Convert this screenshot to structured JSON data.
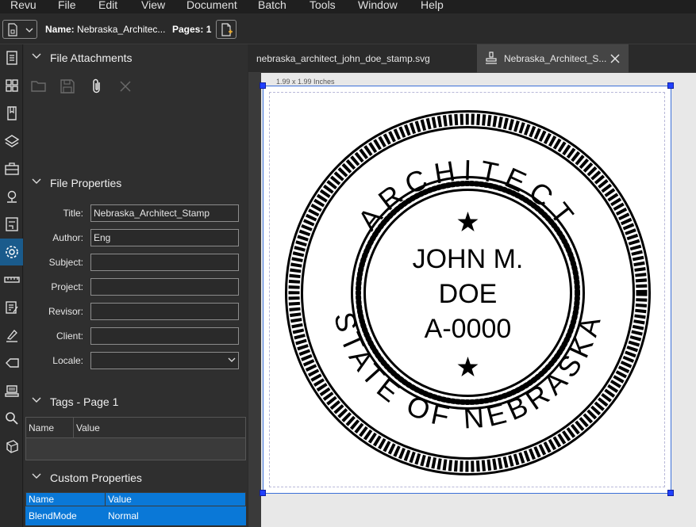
{
  "menu": [
    "Revu",
    "File",
    "Edit",
    "View",
    "Document",
    "Batch",
    "Tools",
    "Window",
    "Help"
  ],
  "toolbar": {
    "name_label": "Name:",
    "name_value": "Nebraska_Architec...",
    "pages_label": "Pages:",
    "pages_value": "1"
  },
  "sidebar_icons": [
    "document-icon",
    "thumbnails-icon",
    "bookmarks-icon",
    "layers-icon",
    "toolbox-icon",
    "places-icon",
    "signatures-icon",
    "properties-icon",
    "measure-icon",
    "markups-list-icon",
    "digital-sign-icon",
    "tag-icon",
    "stamp-icon",
    "search-icon",
    "3d-icon"
  ],
  "panel": {
    "attachments_title": "File Attachments",
    "file_properties_title": "File Properties",
    "properties": [
      {
        "label": "Title:",
        "value": "Nebraska_Architect_Stamp"
      },
      {
        "label": "Author:",
        "value": "Eng"
      },
      {
        "label": "Subject:",
        "value": ""
      },
      {
        "label": "Project:",
        "value": ""
      },
      {
        "label": "Revisor:",
        "value": ""
      },
      {
        "label": "Client:",
        "value": ""
      },
      {
        "label": "Locale:",
        "value": ""
      }
    ],
    "tags_title": "Tags - Page 1",
    "tags_columns": [
      "Name",
      "Value"
    ],
    "custom_title": "Custom Properties",
    "custom_columns": [
      "Name",
      "Value"
    ],
    "custom_rows": [
      {
        "name": "BlendMode",
        "value": "Normal"
      }
    ]
  },
  "tabs": [
    {
      "label": "nebraska_architect_john_doe_stamp.svg",
      "active": false
    },
    {
      "label": "Nebraska_Architect_S...",
      "active": true
    }
  ],
  "document": {
    "dimensions": "1.99 x 1.99 Inches",
    "stamp": {
      "top_text": "ARCHITECT",
      "bottom_text": "STATE OF NEBRASKA",
      "name_line1": "JOHN M.",
      "name_line2": "DOE",
      "number": "A-0000"
    }
  },
  "colors": {
    "accent": "#1a5b8c",
    "selection": "#0a78d7",
    "handle": "#2040ff"
  }
}
